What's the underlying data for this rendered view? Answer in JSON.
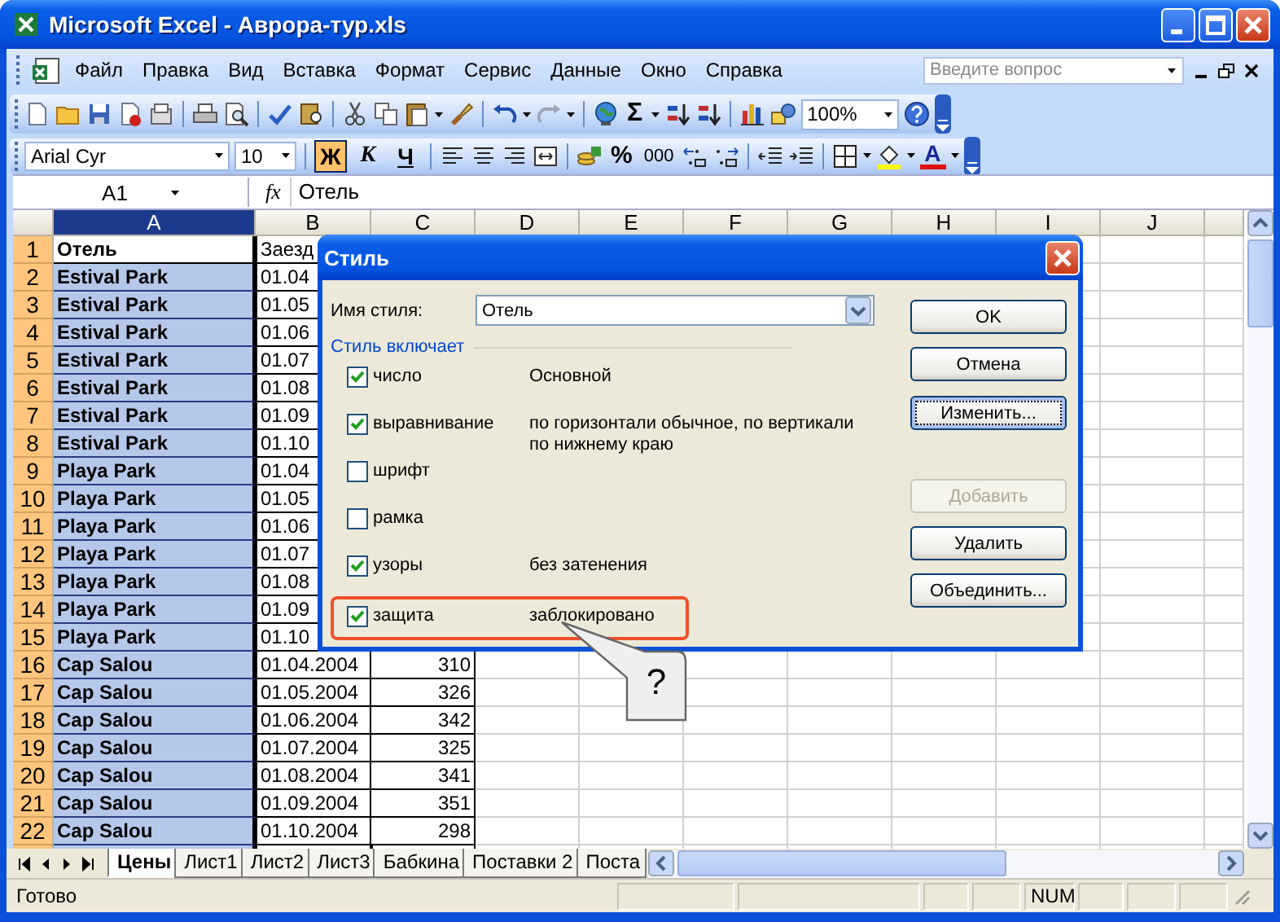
{
  "window": {
    "title": "Microsoft Excel - Аврора-тур.xls"
  },
  "menu": {
    "items": [
      "Файл",
      "Правка",
      "Вид",
      "Вставка",
      "Формат",
      "Сервис",
      "Данные",
      "Окно",
      "Справка"
    ],
    "question_placeholder": "Введите вопрос"
  },
  "standard_toolbar": {
    "sum": "Σ",
    "zoom": "100%"
  },
  "formatting_toolbar": {
    "font": "Arial Cyr",
    "size": "10",
    "bold": {
      "label": "Ж",
      "on": true
    },
    "italic": {
      "label": "К",
      "on": false
    },
    "underline": {
      "label": "Ч",
      "on": false
    },
    "percent": "%",
    "thousands": "000",
    "font_color": "A"
  },
  "formula_bar": {
    "name_box": "A1",
    "fx": "fx",
    "value": "Отель"
  },
  "sheet": {
    "columns": [
      {
        "label": "A",
        "selected": true
      },
      {
        "label": "B",
        "selected": false
      },
      {
        "label": "C",
        "selected": false
      },
      {
        "label": "D",
        "selected": false
      },
      {
        "label": "E",
        "selected": false
      },
      {
        "label": "F",
        "selected": false
      },
      {
        "label": "G",
        "selected": false
      },
      {
        "label": "H",
        "selected": false
      },
      {
        "label": "I",
        "selected": false
      },
      {
        "label": "J",
        "selected": false
      }
    ],
    "rows": [
      {
        "number": "1",
        "selected": true,
        "active": true,
        "cells": [
          "Отель",
          "Заезд"
        ]
      },
      {
        "number": "2",
        "selected": true,
        "active": false,
        "cells": [
          "Estival Park",
          "01.04"
        ]
      },
      {
        "number": "3",
        "selected": true,
        "active": false,
        "cells": [
          "Estival Park",
          "01.05"
        ]
      },
      {
        "number": "4",
        "selected": true,
        "active": false,
        "cells": [
          "Estival Park",
          "01.06"
        ]
      },
      {
        "number": "5",
        "selected": true,
        "active": false,
        "cells": [
          "Estival Park",
          "01.07"
        ]
      },
      {
        "number": "6",
        "selected": true,
        "active": false,
        "cells": [
          "Estival Park",
          "01.08"
        ]
      },
      {
        "number": "7",
        "selected": true,
        "active": false,
        "cells": [
          "Estival Park",
          "01.09"
        ]
      },
      {
        "number": "8",
        "selected": true,
        "active": false,
        "cells": [
          "Estival Park",
          "01.10"
        ]
      },
      {
        "number": "9",
        "selected": true,
        "active": false,
        "cells": [
          "Playa Park",
          "01.04"
        ]
      },
      {
        "number": "10",
        "selected": true,
        "active": false,
        "cells": [
          "Playa Park",
          "01.05"
        ]
      },
      {
        "number": "11",
        "selected": true,
        "active": false,
        "cells": [
          "Playa Park",
          "01.06"
        ]
      },
      {
        "number": "12",
        "selected": true,
        "active": false,
        "cells": [
          "Playa Park",
          "01.07"
        ]
      },
      {
        "number": "13",
        "selected": true,
        "active": false,
        "cells": [
          "Playa Park",
          "01.08"
        ]
      },
      {
        "number": "14",
        "selected": true,
        "active": false,
        "cells": [
          "Playa Park",
          "01.09"
        ]
      },
      {
        "number": "15",
        "selected": true,
        "active": false,
        "cells": [
          "Playa Park",
          "01.10"
        ]
      },
      {
        "number": "16",
        "selected": true,
        "active": false,
        "cells": [
          "Cap Salou",
          "01.04.2004",
          "310"
        ]
      },
      {
        "number": "17",
        "selected": true,
        "active": false,
        "cells": [
          "Cap Salou",
          "01.05.2004",
          "326"
        ]
      },
      {
        "number": "18",
        "selected": true,
        "active": false,
        "cells": [
          "Cap Salou",
          "01.06.2004",
          "342"
        ]
      },
      {
        "number": "19",
        "selected": true,
        "active": false,
        "cells": [
          "Cap Salou",
          "01.07.2004",
          "325"
        ]
      },
      {
        "number": "20",
        "selected": true,
        "active": false,
        "cells": [
          "Cap Salou",
          "01.08.2004",
          "341"
        ]
      },
      {
        "number": "21",
        "selected": true,
        "active": false,
        "cells": [
          "Cap Salou",
          "01.09.2004",
          "351"
        ]
      },
      {
        "number": "22",
        "selected": true,
        "active": false,
        "cells": [
          "Cap Salou",
          "01.10.2004",
          "298"
        ]
      }
    ]
  },
  "sheet_tabs": [
    {
      "label": "Цены",
      "selected": true
    },
    {
      "label": "Лист1",
      "selected": false
    },
    {
      "label": "Лист2",
      "selected": false
    },
    {
      "label": "Лист3",
      "selected": false
    },
    {
      "label": "Бабкина",
      "selected": false
    },
    {
      "label": "Поставки 2",
      "selected": false
    },
    {
      "label": "Поста",
      "selected": false
    }
  ],
  "status_bar": {
    "text": "Готово",
    "indicator": "NUM"
  },
  "dialog": {
    "title": "Стиль",
    "name_label": "Имя стиля:",
    "name_value": "Отель",
    "group_label": "Стиль включает",
    "items": [
      {
        "label": "число",
        "checked": true,
        "description": "Основной",
        "highlighted": false
      },
      {
        "label": "выравнивание",
        "checked": true,
        "description": "по горизонтали обычное, по вертикали по нижнему краю",
        "highlighted": false
      },
      {
        "label": "шрифт",
        "checked": false,
        "highlighted": false
      },
      {
        "label": "рамка",
        "checked": false,
        "highlighted": false
      },
      {
        "label": "узоры",
        "checked": true,
        "description": "без затенения",
        "highlighted": false
      },
      {
        "label": "защита",
        "checked": true,
        "description": "заблокировано",
        "highlighted": true
      }
    ],
    "buttons": [
      {
        "label": "OK",
        "disabled": false,
        "focused": false
      },
      {
        "label": "Отмена",
        "disabled": false,
        "focused": false
      },
      {
        "label": "Изменить...",
        "disabled": false,
        "focused": true
      },
      {
        "label": "Добавить",
        "disabled": true,
        "focused": false
      },
      {
        "label": "Удалить",
        "disabled": false,
        "focused": false
      },
      {
        "label": "Объединить...",
        "disabled": false,
        "focused": false
      }
    ]
  },
  "callout": {
    "text": "?"
  }
}
